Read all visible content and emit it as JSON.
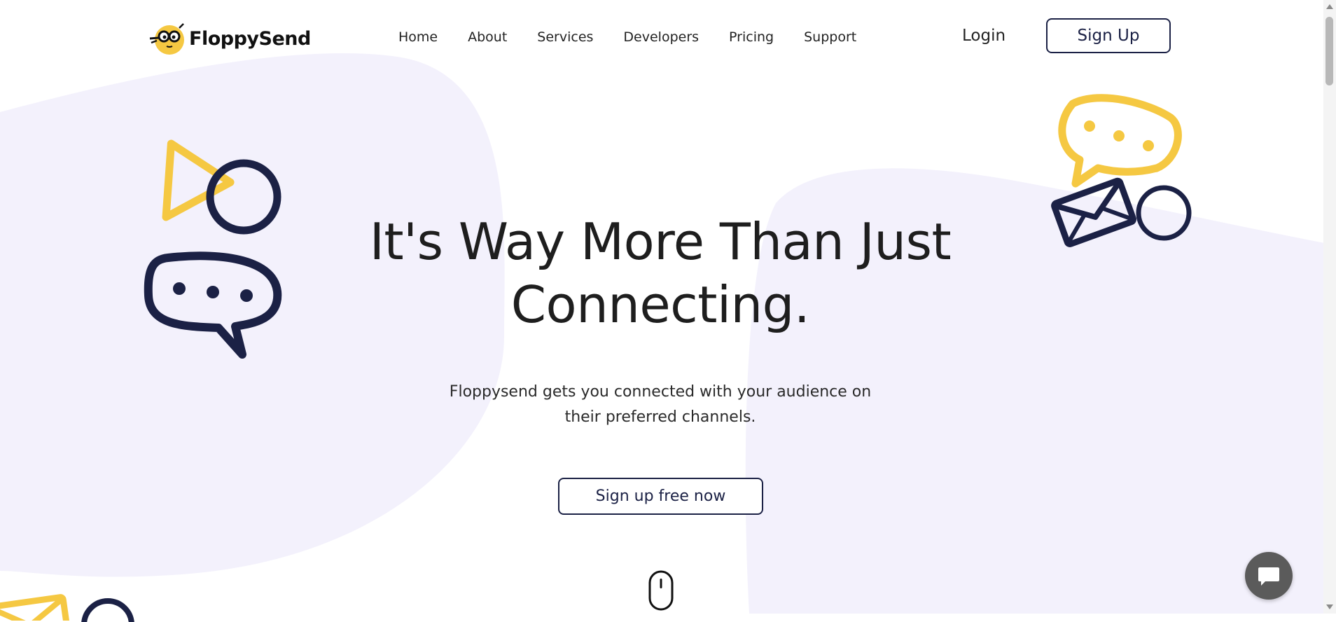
{
  "brand": {
    "name": "FloppySend"
  },
  "nav": {
    "links": [
      "Home",
      "About",
      "Services",
      "Developers",
      "Pricing",
      "Support"
    ],
    "login_label": "Login",
    "signup_label": "Sign Up"
  },
  "hero": {
    "title_line1": "It's Way More Than Just",
    "title_line2": "Connecting.",
    "subtitle_line1": "Floppysend gets you connected with your audience on",
    "subtitle_line2": "their preferred channels.",
    "cta_label": "Sign up free now"
  },
  "colors": {
    "navy": "#1b2145",
    "yellow": "#f5c842",
    "blob": "#f3f1fc",
    "fab": "#5b5b5b"
  },
  "icons": [
    "play-triangle-icon",
    "circle-icon",
    "speech-bubble-icon",
    "envelope-icon",
    "mouse-scroll-icon",
    "chat-icon"
  ]
}
